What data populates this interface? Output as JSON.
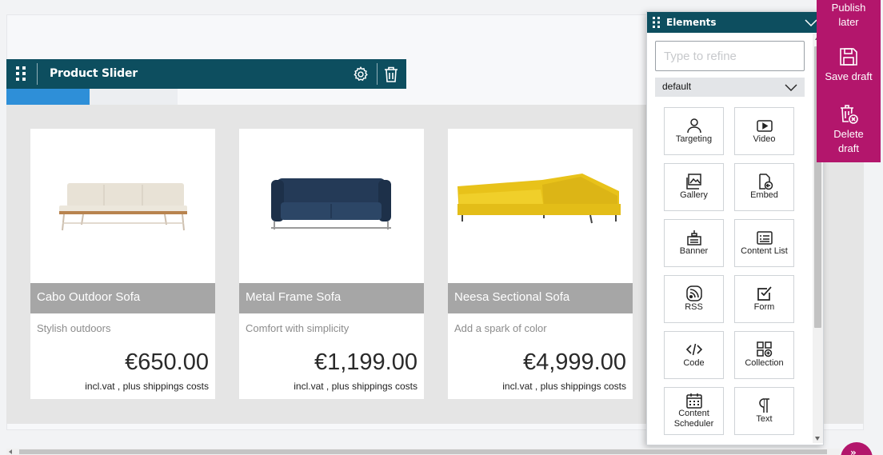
{
  "component": {
    "title": "Product Slider",
    "icons": {
      "grip": "drag-grip-icon",
      "settings": "gear-icon",
      "delete": "trash-icon"
    }
  },
  "products": [
    {
      "name": "Cabo Outdoor Sofa",
      "description": "Stylish outdoors",
      "price": "€650.00",
      "vat_note": "incl.vat , plus shippings costs",
      "image": "cream-outdoor-sofa-image"
    },
    {
      "name": "Metal Frame Sofa",
      "description": "Comfort with simplicity",
      "price": "€1,199.00",
      "vat_note": "incl.vat , plus shippings costs",
      "image": "navy-metal-frame-sofa-image"
    },
    {
      "name": "Neesa Sectional Sofa",
      "description": "Add a spark of color",
      "price": "€4,999.00",
      "vat_note": "incl.vat , plus shippings costs",
      "image": "yellow-sectional-sofa-image"
    }
  ],
  "elements_panel": {
    "title": "Elements",
    "search_placeholder": "Type to refine",
    "category": "default",
    "items": [
      {
        "label": "Targeting",
        "icon": "person-icon"
      },
      {
        "label": "Video",
        "icon": "video-play-icon"
      },
      {
        "label": "Gallery",
        "icon": "gallery-icon"
      },
      {
        "label": "Embed",
        "icon": "embed-icon"
      },
      {
        "label": "Banner",
        "icon": "banner-icon"
      },
      {
        "label": "Content List",
        "icon": "content-list-icon"
      },
      {
        "label": "RSS",
        "icon": "rss-icon"
      },
      {
        "label": "Form",
        "icon": "form-checkbox-icon"
      },
      {
        "label": "Code",
        "icon": "code-icon"
      },
      {
        "label": "Collection",
        "icon": "collection-icon"
      },
      {
        "label": "Content Scheduler",
        "icon": "calendar-icon"
      },
      {
        "label": "Text",
        "icon": "pilcrow-icon"
      }
    ]
  },
  "actions": {
    "publish_later": "Publish later",
    "save_draft": "Save draft",
    "delete_draft": "Delete draft"
  },
  "colors": {
    "brand_teal": "#0d4e5f",
    "accent_magenta": "#b3166c",
    "tab_blue": "#2e8fd8"
  }
}
